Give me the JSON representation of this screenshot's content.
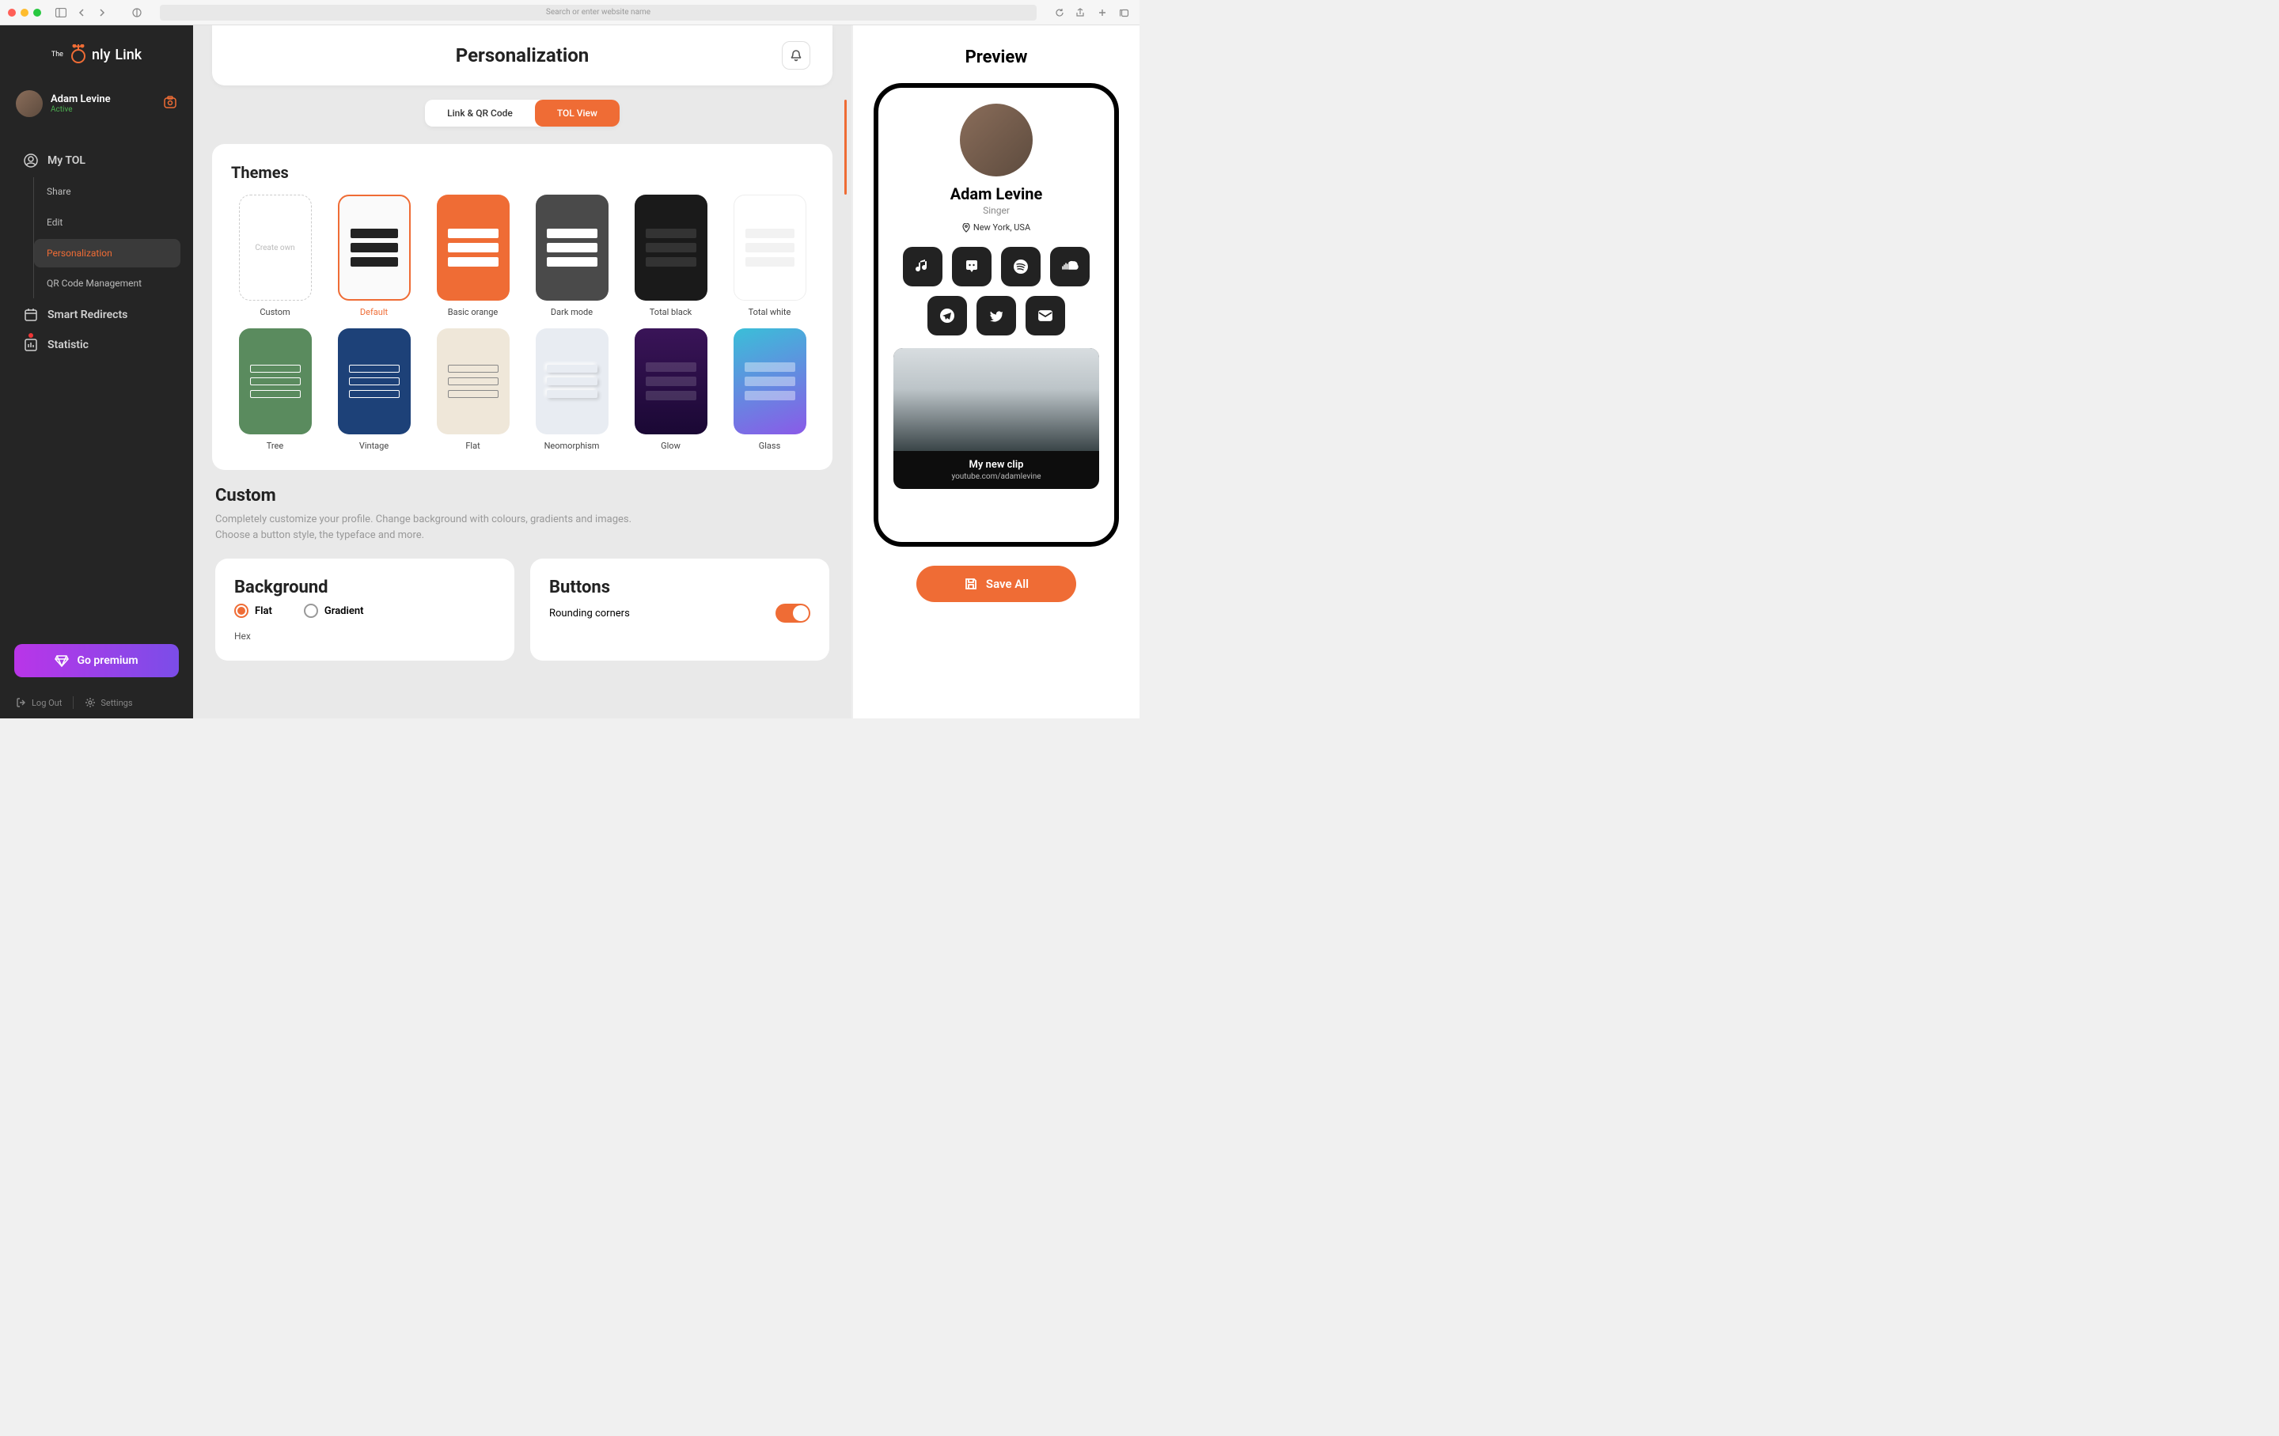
{
  "chrome": {
    "placeholder": "Search or enter website name"
  },
  "logo": {
    "the": "The",
    "nly": "nly",
    "link": "Link"
  },
  "profile": {
    "name": "Adam Levine",
    "status": "Active"
  },
  "menu": {
    "mytol": "My TOL",
    "sub": {
      "share": "Share",
      "edit": "Edit",
      "personalization": "Personalization",
      "qr": "QR Code Management"
    },
    "redirects": "Smart Redirects",
    "statistic": "Statistic"
  },
  "premium": "Go premium",
  "footer": {
    "logout": "Log Out",
    "settings": "Settings"
  },
  "header": {
    "title": "Personalization"
  },
  "tabs": {
    "link": "Link & QR Code",
    "tol": "TOL View"
  },
  "themes": {
    "title": "Themes",
    "row1": [
      {
        "label": "Custom",
        "create": "Create own"
      },
      {
        "label": "Default"
      },
      {
        "label": "Basic orange"
      },
      {
        "label": "Dark mode"
      },
      {
        "label": "Total black"
      },
      {
        "label": "Total white"
      }
    ],
    "row2": [
      {
        "label": "Tree"
      },
      {
        "label": "Vintage"
      },
      {
        "label": "Flat"
      },
      {
        "label": "Neomorphism"
      },
      {
        "label": "Glow"
      },
      {
        "label": "Glass"
      }
    ]
  },
  "custom": {
    "title": "Custom",
    "desc1": "Completely customize your profile. Change background with colours, gradients and images.",
    "desc2": "Choose a button style, the typeface and more."
  },
  "background": {
    "title": "Background",
    "flat": "Flat",
    "gradient": "Gradient",
    "hex": "Hex"
  },
  "buttons": {
    "title": "Buttons",
    "rounding": "Rounding corners"
  },
  "preview": {
    "title": "Preview",
    "name": "Adam Levine",
    "sub": "Singer",
    "loc": "New York, USA",
    "clip": {
      "title": "My new clip",
      "url": "youtube.com/adamlevine"
    },
    "save": "Save All"
  }
}
